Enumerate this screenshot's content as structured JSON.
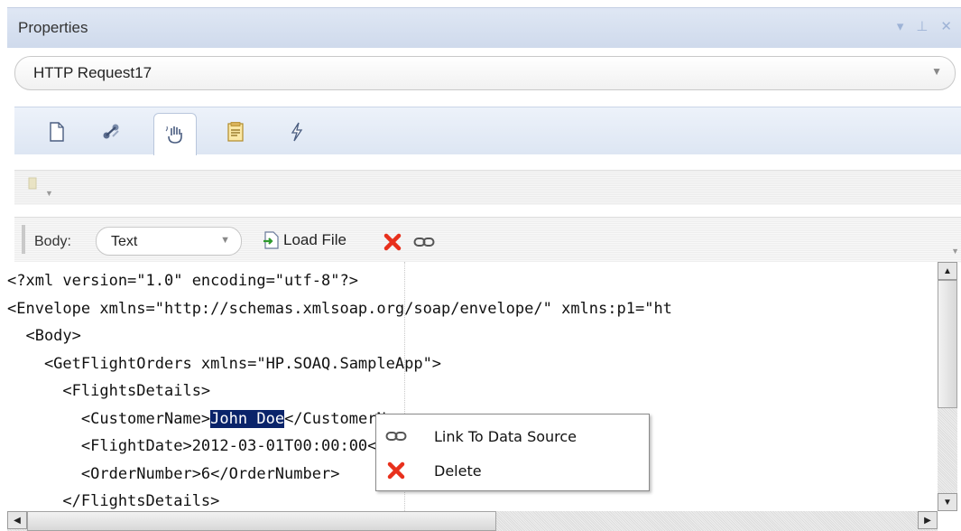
{
  "panel": {
    "title": "Properties"
  },
  "selector": {
    "value": "HTTP Request17"
  },
  "tabs": [
    {
      "icon": "page-icon",
      "active": false
    },
    {
      "icon": "connector-icon",
      "active": false
    },
    {
      "icon": "hand-wave-icon",
      "active": true
    },
    {
      "icon": "document-lines-icon",
      "active": false
    },
    {
      "icon": "lightning-icon",
      "active": false
    }
  ],
  "body_toolbar": {
    "body_label": "Body:",
    "format_value": "Text",
    "load_file_label": "Load File"
  },
  "editor": {
    "lines": [
      "<?xml version=\"1.0\" encoding=\"utf-8\"?>",
      "<Envelope xmlns=\"http://schemas.xmlsoap.org/soap/envelope/\" xmlns:p1=\"ht",
      "  <Body>",
      "    <GetFlightOrders xmlns=\"HP.SOAQ.SampleApp\">",
      "      <FlightsDetails>",
      "        <CustomerName>John Doe</CustomerName>",
      "        <FlightDate>2012-03-01T00:00:00</FlightDate>",
      "        <OrderNumber>6</OrderNumber>",
      "      </FlightsDetails>"
    ],
    "selection": {
      "line_index": 5,
      "text": "John Doe",
      "before": "        <CustomerName>",
      "after": "</CustomerName>"
    }
  },
  "context_menu": {
    "items": [
      {
        "label": "Link To Data Source",
        "icon": "link-icon"
      },
      {
        "label": "Delete",
        "icon": "delete-x-icon"
      }
    ]
  },
  "colors": {
    "selection_bg": "#0a246a",
    "title_ctrl": "#9eb3d6",
    "delete_red": "#e8301c"
  }
}
